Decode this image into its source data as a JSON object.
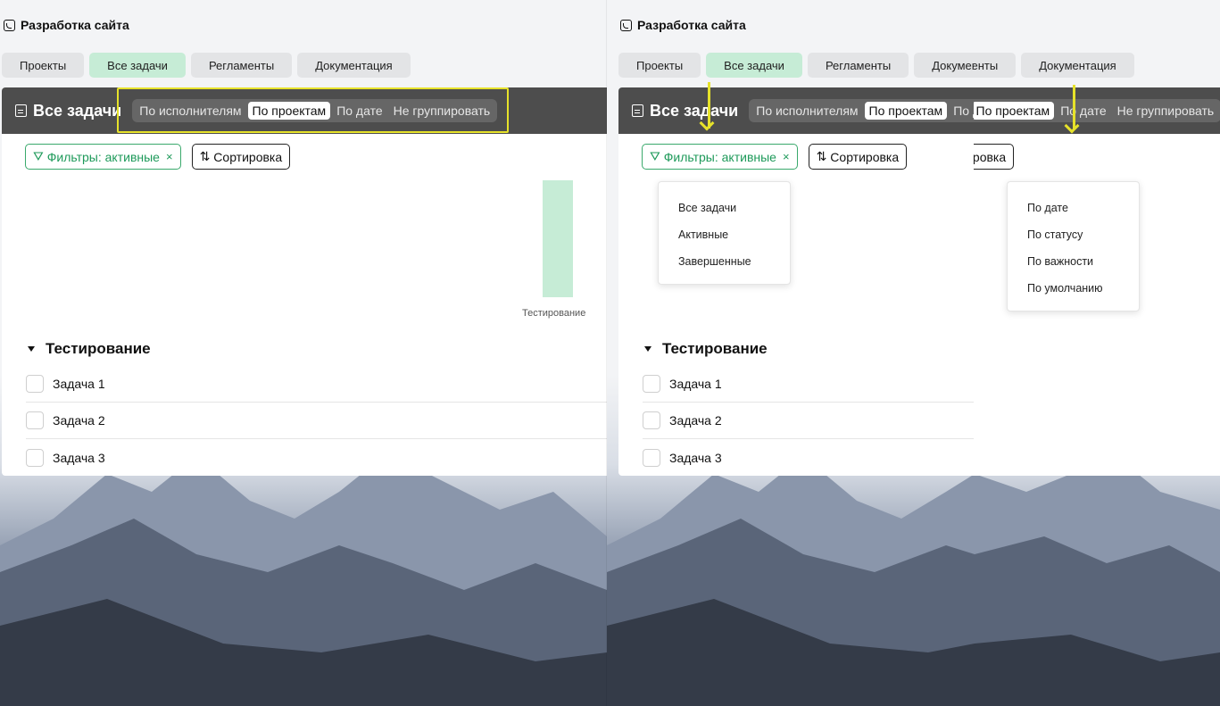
{
  "site": {
    "title": "Разработка сайта"
  },
  "tabs": [
    {
      "label": "Проекты",
      "active": false
    },
    {
      "label": "Все задачи",
      "active": true
    },
    {
      "label": "Регламенты",
      "active": false
    },
    {
      "label": "Документация",
      "active": false
    }
  ],
  "card": {
    "title": "Все задачи",
    "grouping": [
      {
        "label": "По исполнителям",
        "selected": false
      },
      {
        "label": "По проектам",
        "selected": true
      },
      {
        "label": "По дате",
        "selected": false
      },
      {
        "label": "Не группировать",
        "selected": false
      }
    ],
    "filter_label": "Фильтры: активные",
    "filter_clear": "×",
    "sort_label": "Сортировка",
    "chart": {
      "label": "Тестирование"
    },
    "group_title": "Тестирование",
    "tasks": [
      "Задача 1",
      "Задача 2",
      "Задача 3"
    ]
  },
  "filter_menu": [
    "Все задачи",
    "Активные",
    "Завершенные"
  ],
  "sort_menu": [
    "По дате",
    "По статусу",
    "По важности",
    "По умолчанию"
  ],
  "colors": {
    "accent": "#1e9a5a",
    "active_tab": "#c6ecd6",
    "header": "#4d4d4d",
    "highlight": "#e6e22a"
  }
}
